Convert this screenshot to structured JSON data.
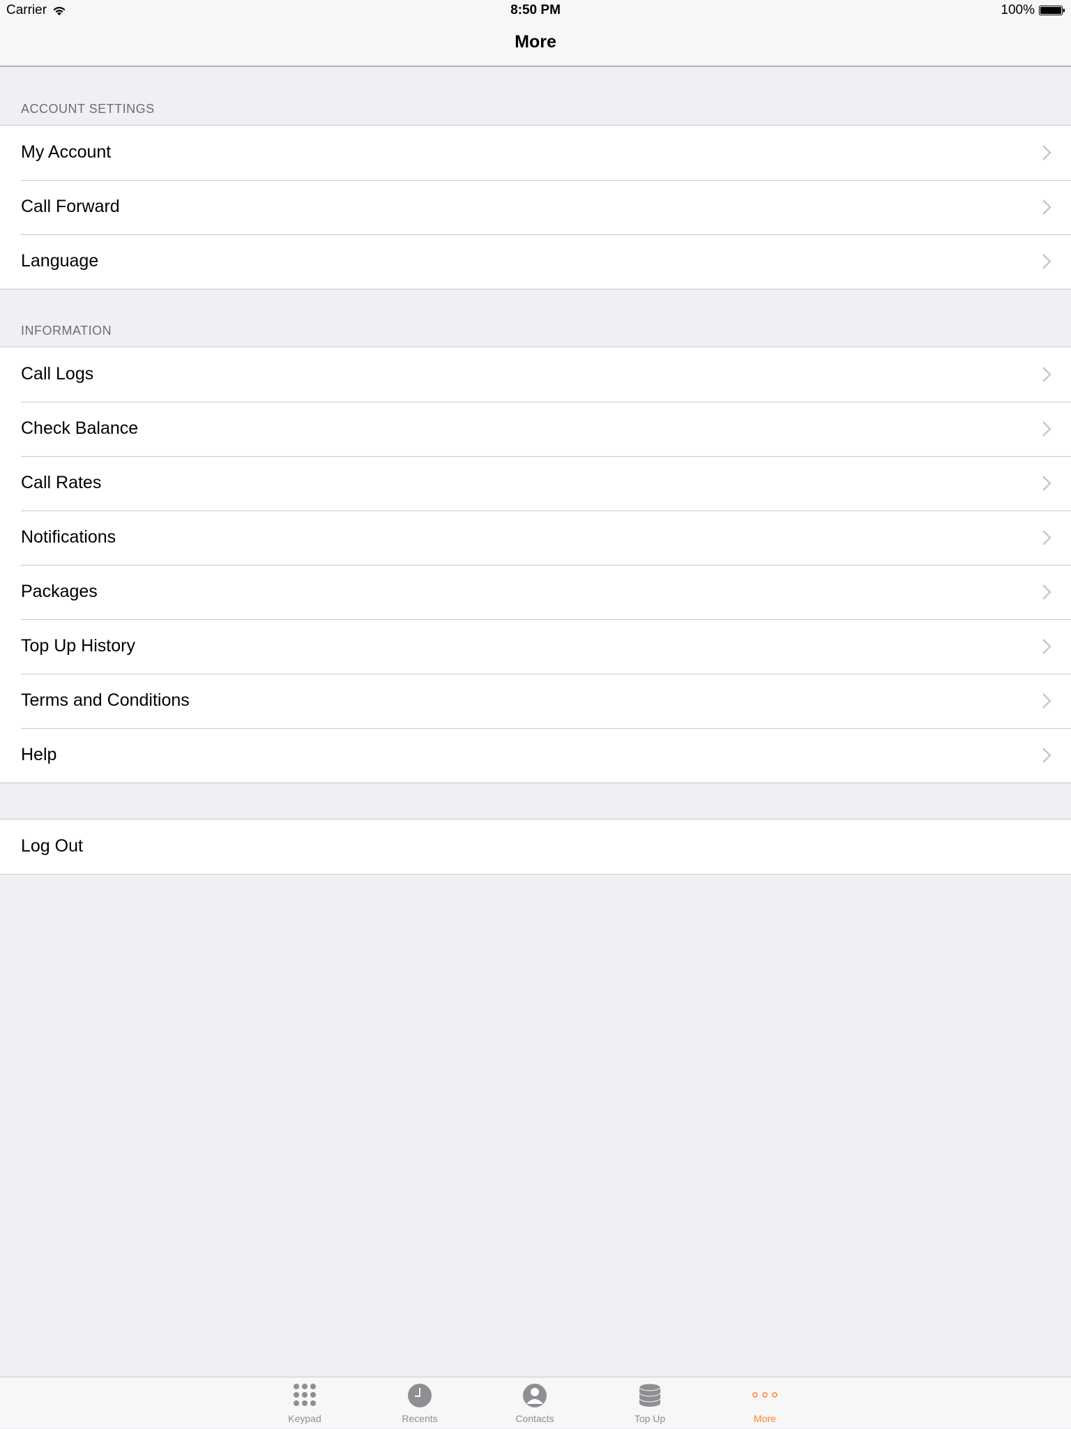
{
  "status_bar": {
    "carrier": "Carrier",
    "time": "8:50 PM",
    "battery": "100%"
  },
  "nav": {
    "title": "More"
  },
  "sections": {
    "account": {
      "header": "ACCOUNT SETTINGS",
      "items": [
        {
          "label": "My Account"
        },
        {
          "label": "Call Forward"
        },
        {
          "label": "Language"
        }
      ]
    },
    "information": {
      "header": "INFORMATION",
      "items": [
        {
          "label": "Call Logs"
        },
        {
          "label": "Check Balance"
        },
        {
          "label": "Call Rates"
        },
        {
          "label": "Notifications"
        },
        {
          "label": "Packages"
        },
        {
          "label": "Top Up History"
        },
        {
          "label": "Terms and Conditions"
        },
        {
          "label": "Help"
        }
      ]
    },
    "logout": {
      "label": "Log Out"
    }
  },
  "tab_bar": {
    "tabs": [
      {
        "label": "Keypad",
        "icon": "keypad-icon"
      },
      {
        "label": "Recents",
        "icon": "clock-icon"
      },
      {
        "label": "Contacts",
        "icon": "contact-icon"
      },
      {
        "label": "Top Up",
        "icon": "coins-icon"
      },
      {
        "label": "More",
        "icon": "more-icon",
        "active": true
      }
    ]
  },
  "colors": {
    "accent": "#ff7f2a",
    "inactive": "#8e8e93",
    "background": "#efeff4"
  }
}
